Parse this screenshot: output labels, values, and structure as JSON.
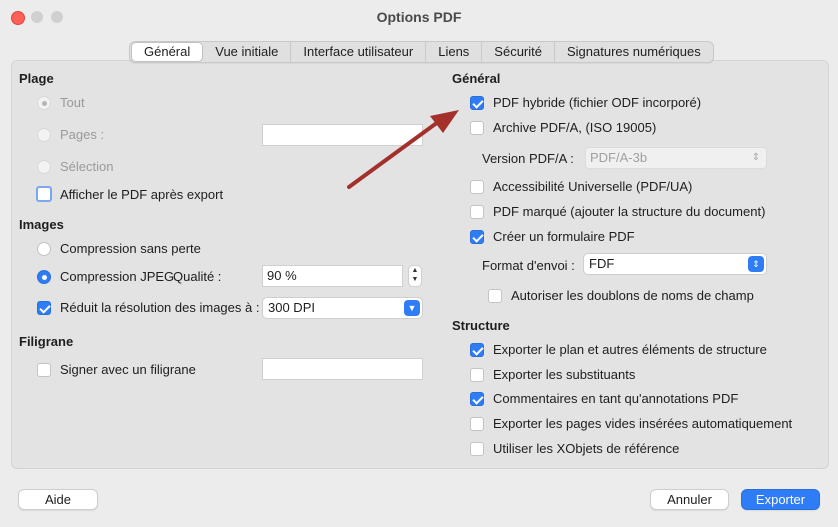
{
  "window": {
    "title": "Options PDF"
  },
  "tabs": [
    "Général",
    "Vue initiale",
    "Interface utilisateur",
    "Liens",
    "Sécurité",
    "Signatures numériques"
  ],
  "left": {
    "plage": {
      "heading": "Plage",
      "all": "Tout",
      "pages": "Pages :",
      "selection": "Sélection",
      "show_after_export": "Afficher le PDF après export"
    },
    "images": {
      "heading": "Images",
      "lossless": "Compression sans perte",
      "jpeg": "Compression JPEG",
      "quality_label": "Qualité :",
      "quality_value": "90 %",
      "reduce_res": "Réduit la résolution des images à :",
      "dpi_value": "300 DPI"
    },
    "filigrane": {
      "heading": "Filigrane",
      "sign": "Signer avec un filigrane"
    }
  },
  "right": {
    "general": {
      "heading": "Général",
      "hybrid": "PDF hybride (fichier ODF incorporé)",
      "archive": "Archive PDF/A, (ISO 19005)",
      "version_label": "Version PDF/A :",
      "version_value": "PDF/A-3b",
      "accessibility": "Accessibilité Universelle (PDF/UA)",
      "tagged": "PDF marqué (ajouter la structure du document)",
      "form": "Créer un formulaire PDF",
      "format_label": "Format d'envoi :",
      "format_value": "FDF",
      "duplicates": "Autoriser les doublons de noms de champ"
    },
    "structure": {
      "heading": "Structure",
      "outline": "Exporter le plan et autres éléments de structure",
      "placeholders": "Exporter les substituants",
      "comments": "Commentaires en tant qu'annotations PDF",
      "blank_pages": "Exporter les pages vides insérées automatiquement",
      "xobjects": "Utiliser les XObjets de référence"
    }
  },
  "buttons": {
    "help": "Aide",
    "cancel": "Annuler",
    "export": "Exporter"
  },
  "colors": {
    "accent": "#2e7cf6",
    "arrow": "#a3302a"
  }
}
